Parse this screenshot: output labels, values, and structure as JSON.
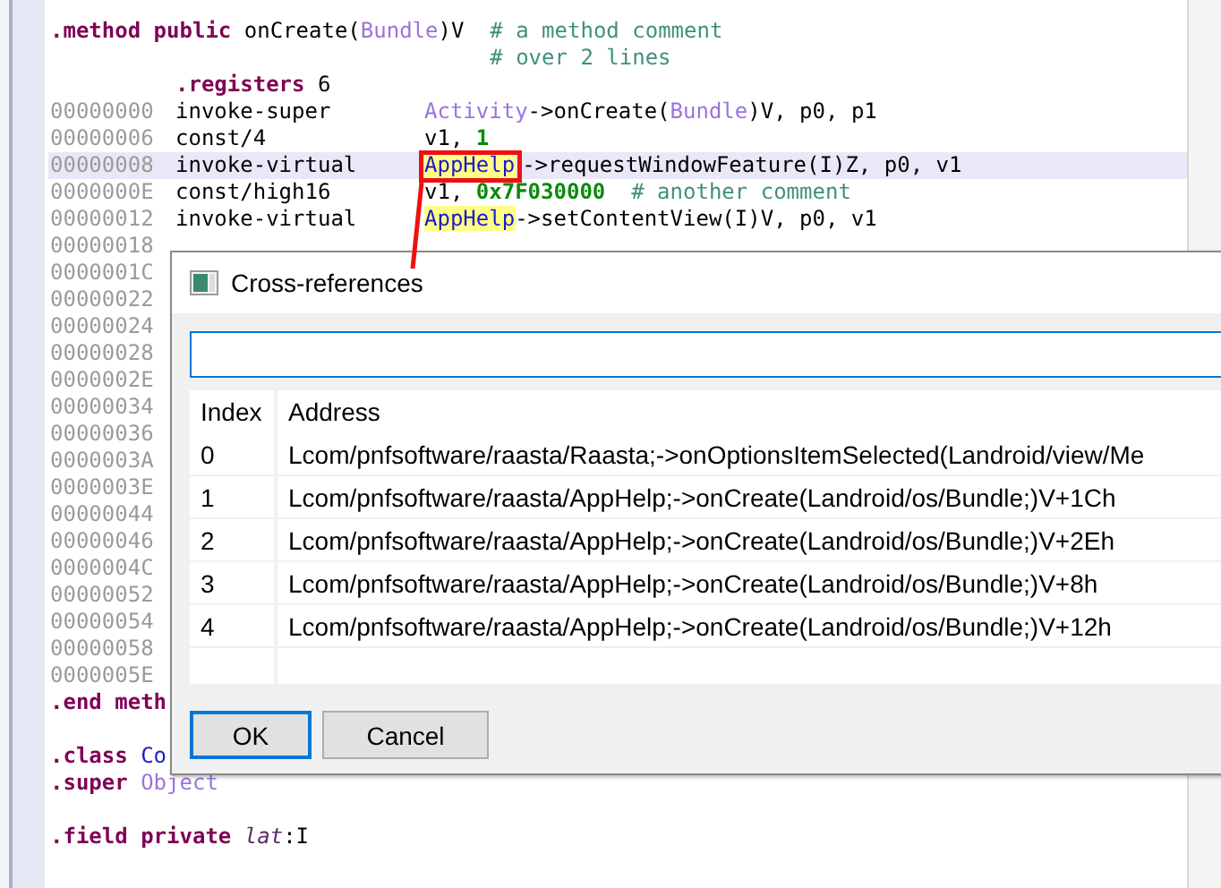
{
  "editor": {
    "lines": [
      {
        "kind": "directive",
        "tokens": [
          {
            "text": ".method public",
            "kind": "keyword"
          },
          {
            "text": " onCreate(",
            "kind": "plain"
          },
          {
            "text": "Bundle",
            "kind": "type"
          },
          {
            "text": ")V",
            "kind": "plain"
          }
        ],
        "comment": "# a method comment"
      },
      {
        "kind": "continuation",
        "comment": "# over 2 lines"
      },
      {
        "kind": "body-directive",
        "tokens": [
          {
            "text": ".registers",
            "kind": "keyword"
          },
          {
            "text": " 6",
            "kind": "plain"
          }
        ]
      },
      {
        "kind": "instruction",
        "selected": false,
        "address": "00000000",
        "opcode": "invoke-super",
        "operands": [
          {
            "text": "Activity",
            "kind": "type"
          },
          {
            "text": "->onCreate(",
            "kind": "plain"
          },
          {
            "text": "Bundle",
            "kind": "type"
          },
          {
            "text": ")V, p0, p1",
            "kind": "plain"
          }
        ]
      },
      {
        "kind": "instruction",
        "selected": false,
        "address": "00000006",
        "opcode": "const/4",
        "operands": [
          {
            "text": "v1, ",
            "kind": "plain"
          },
          {
            "text": "1",
            "kind": "number"
          }
        ]
      },
      {
        "kind": "instruction",
        "selected": true,
        "address": "00000008",
        "opcode": "invoke-virtual",
        "operands": [
          {
            "text": "AppHelp",
            "kind": "marked"
          },
          {
            "text": "->requestWindowFeature(I)Z, p0, v1",
            "kind": "plain"
          }
        ]
      },
      {
        "kind": "instruction",
        "selected": false,
        "address": "0000000E",
        "opcode": "const/high16",
        "operands": [
          {
            "text": "v1, ",
            "kind": "plain"
          },
          {
            "text": "0x7F030000",
            "kind": "number"
          }
        ],
        "comment": "# another comment"
      },
      {
        "kind": "instruction",
        "selected": false,
        "address": "00000012",
        "opcode": "invoke-virtual",
        "operands": [
          {
            "text": "AppHelp",
            "kind": "marked"
          },
          {
            "text": "->setContentView(I)V, p0, v1",
            "kind": "plain"
          }
        ]
      },
      {
        "kind": "instruction",
        "selected": false,
        "address": "00000018"
      },
      {
        "kind": "instruction",
        "selected": false,
        "address": "0000001C"
      },
      {
        "kind": "instruction",
        "selected": false,
        "address": "00000022"
      },
      {
        "kind": "instruction",
        "selected": false,
        "address": "00000024"
      },
      {
        "kind": "instruction",
        "selected": false,
        "address": "00000028"
      },
      {
        "kind": "instruction",
        "selected": false,
        "address": "0000002E"
      },
      {
        "kind": "instruction",
        "selected": false,
        "address": "00000034"
      },
      {
        "kind": "instruction",
        "selected": false,
        "address": "00000036"
      },
      {
        "kind": "instruction",
        "selected": false,
        "address": "0000003A"
      },
      {
        "kind": "instruction",
        "selected": false,
        "address": "0000003E"
      },
      {
        "kind": "instruction",
        "selected": false,
        "address": "00000044"
      },
      {
        "kind": "instruction",
        "selected": false,
        "address": "00000046"
      },
      {
        "kind": "instruction",
        "selected": false,
        "address": "0000004C"
      },
      {
        "kind": "instruction",
        "selected": false,
        "address": "00000052"
      },
      {
        "kind": "instruction",
        "selected": false,
        "address": "00000054"
      },
      {
        "kind": "instruction",
        "selected": false,
        "address": "00000058"
      },
      {
        "kind": "instruction",
        "selected": false,
        "address": "0000005E"
      },
      {
        "kind": "directive",
        "tokens": [
          {
            "text": ".end meth",
            "kind": "keyword"
          }
        ]
      },
      {
        "kind": "blank"
      },
      {
        "kind": "directive",
        "tokens": [
          {
            "text": ".class",
            "kind": "keyword"
          },
          {
            "text": " Co",
            "kind": "class"
          }
        ]
      },
      {
        "kind": "directive",
        "tokens": [
          {
            "text": ".super",
            "kind": "keyword"
          },
          {
            "text": " Object",
            "kind": "type"
          }
        ]
      },
      {
        "kind": "blank"
      },
      {
        "kind": "directive",
        "tokens": [
          {
            "text": ".field private",
            "kind": "keyword"
          },
          {
            "text": " lat",
            "kind": "field"
          },
          {
            "text": ":I",
            "kind": "plain"
          }
        ]
      }
    ]
  },
  "dialog": {
    "title": "Cross-references",
    "table": {
      "columns": [
        "Index",
        "Address"
      ],
      "rows": [
        [
          "0",
          "Lcom/pnfsoftware/raasta/Raasta;->onOptionsItemSelected(Landroid/view/Me"
        ],
        [
          "1",
          "Lcom/pnfsoftware/raasta/AppHelp;->onCreate(Landroid/os/Bundle;)V+1Ch"
        ],
        [
          "2",
          "Lcom/pnfsoftware/raasta/AppHelp;->onCreate(Landroid/os/Bundle;)V+2Eh"
        ],
        [
          "3",
          "Lcom/pnfsoftware/raasta/AppHelp;->onCreate(Landroid/os/Bundle;)V+8h"
        ],
        [
          "4",
          "Lcom/pnfsoftware/raasta/AppHelp;->onCreate(Landroid/os/Bundle;)V+12h"
        ]
      ]
    },
    "buttons": [
      {
        "label": "OK",
        "default": true
      },
      {
        "label": "Cancel",
        "default": false
      }
    ]
  }
}
